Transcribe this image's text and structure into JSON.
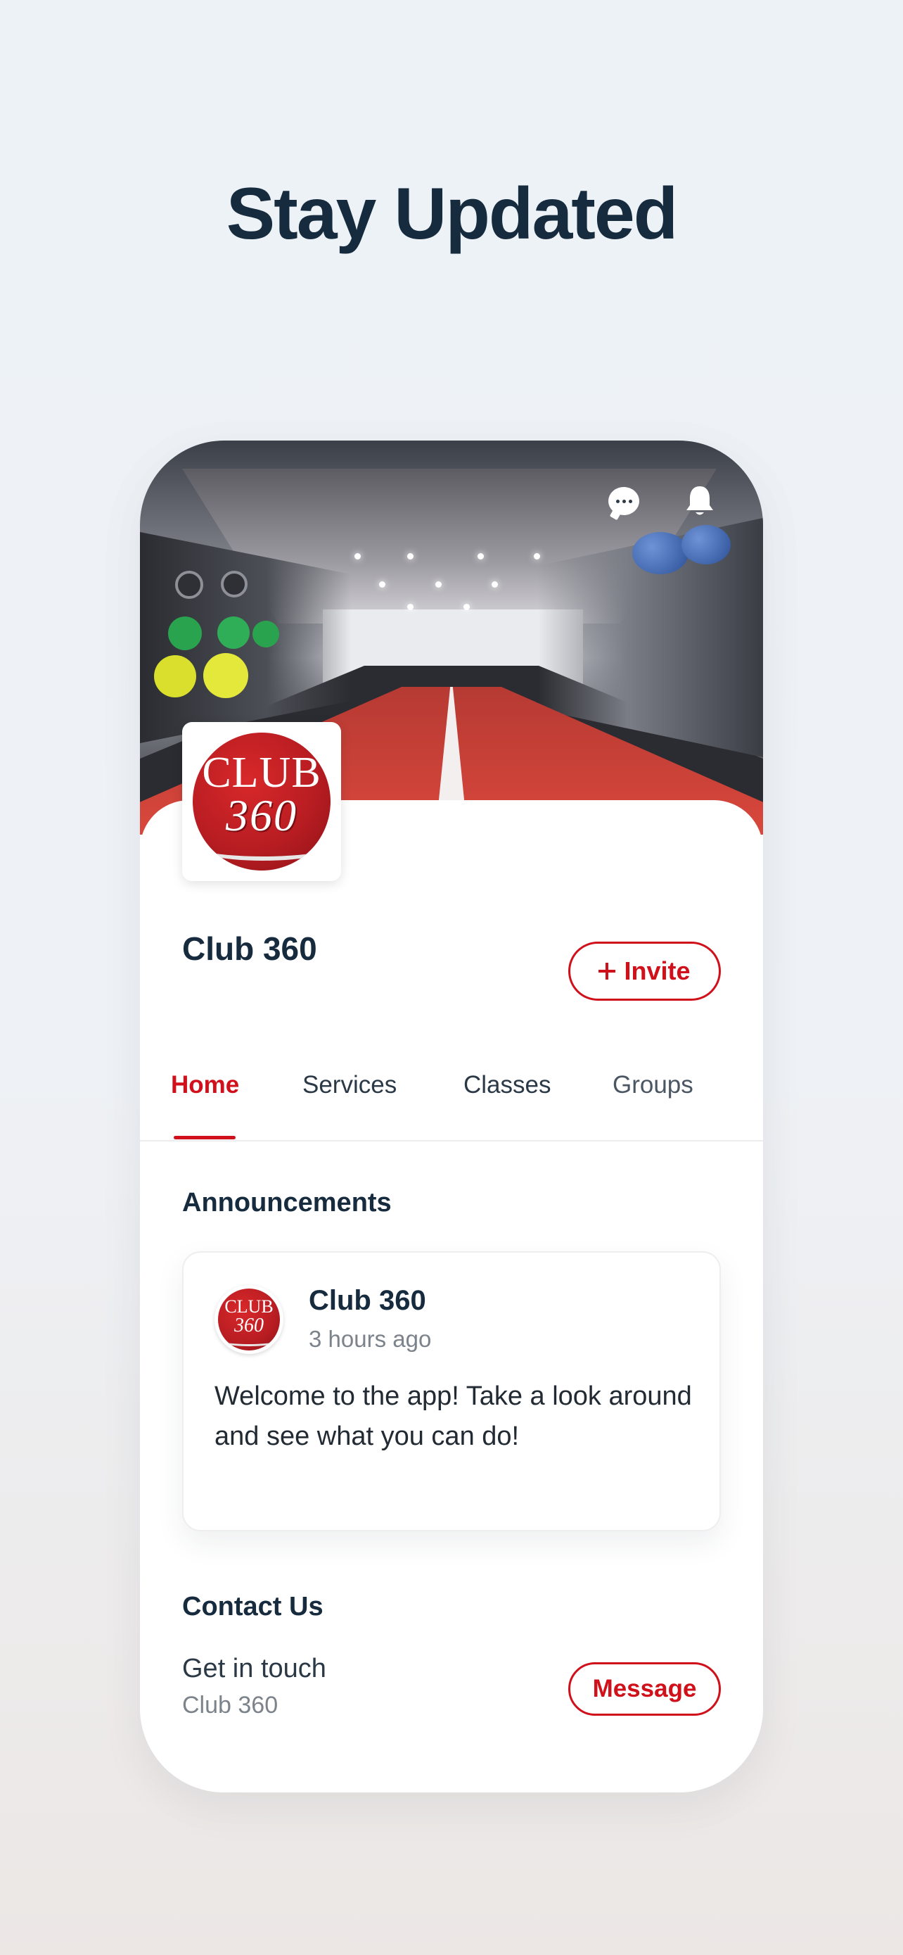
{
  "headline": "Stay Updated",
  "hero": {
    "chat_icon": "chat-bubble-icon",
    "bell_icon": "bell-icon"
  },
  "logo": {
    "line1": "CLUB",
    "line2": "360"
  },
  "profile": {
    "name": "Club 360",
    "invite_label": "Invite"
  },
  "tabs": [
    {
      "label": "Home",
      "active": true
    },
    {
      "label": "Services",
      "active": false
    },
    {
      "label": "Classes",
      "active": false
    },
    {
      "label": "Groups",
      "active": false
    }
  ],
  "announcements": {
    "title": "Announcements",
    "items": [
      {
        "author": "Club 360",
        "time": "3 hours ago",
        "body": "Welcome to the app! Take a look around and see what you can do!"
      }
    ]
  },
  "contact": {
    "title": "Contact Us",
    "subtitle": "Get in touch",
    "name": "Club 360",
    "message_label": "Message"
  },
  "colors": {
    "accent": "#d0111b",
    "text_primary": "#172b3e",
    "text_muted": "#7c838b"
  }
}
